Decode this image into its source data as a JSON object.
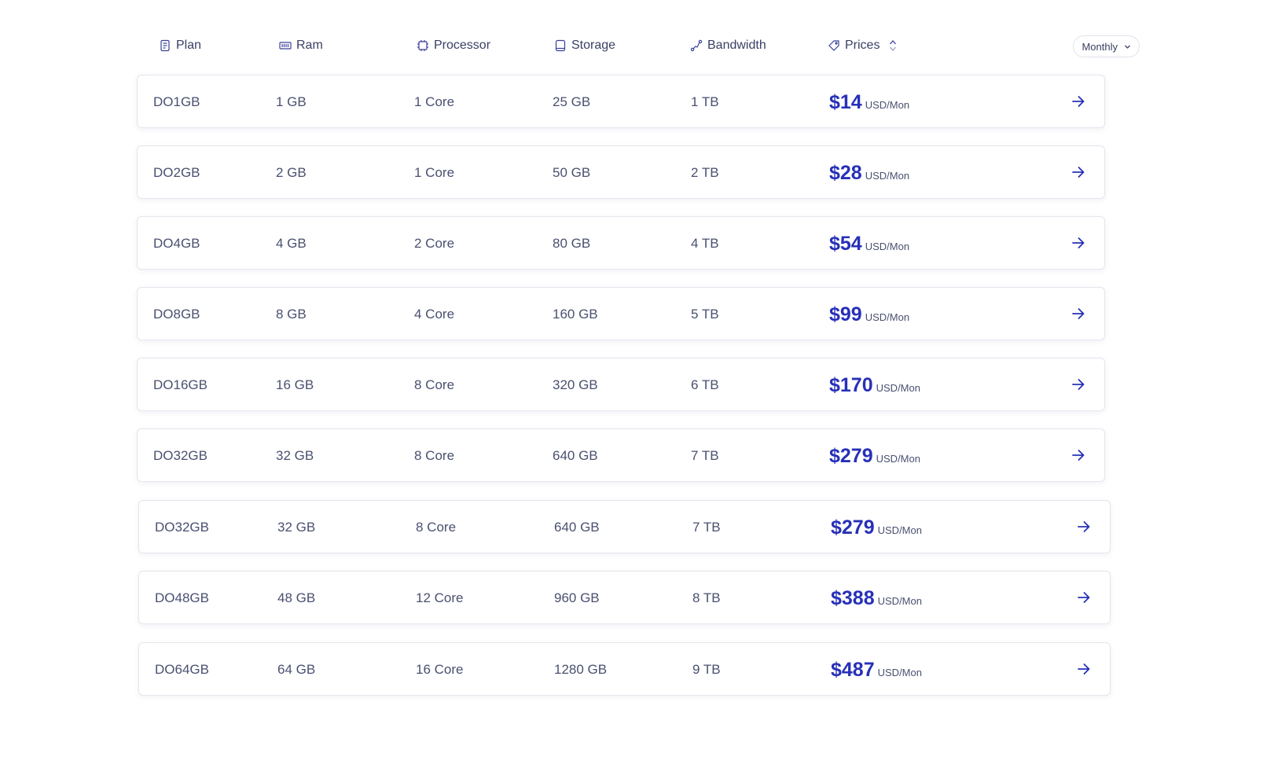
{
  "header": {
    "plan": "Plan",
    "ram": "Ram",
    "processor": "Processor",
    "storage": "Storage",
    "bandwidth": "Bandwidth",
    "prices": "Prices",
    "billing_select": "Monthly"
  },
  "rows": [
    {
      "plan": "DO1GB",
      "ram": "1 GB",
      "processor": "1 Core",
      "storage": "25 GB",
      "bandwidth": "1 TB",
      "price": "$14",
      "unit": "USD/Mon"
    },
    {
      "plan": "DO2GB",
      "ram": "2 GB",
      "processor": "1 Core",
      "storage": "50 GB",
      "bandwidth": "2 TB",
      "price": "$28",
      "unit": "USD/Mon"
    },
    {
      "plan": "DO4GB",
      "ram": "4 GB",
      "processor": "2 Core",
      "storage": "80 GB",
      "bandwidth": "4 TB",
      "price": "$54",
      "unit": "USD/Mon"
    },
    {
      "plan": "DO8GB",
      "ram": "8 GB",
      "processor": "4 Core",
      "storage": "160 GB",
      "bandwidth": "5 TB",
      "price": "$99",
      "unit": "USD/Mon"
    },
    {
      "plan": "DO16GB",
      "ram": "16 GB",
      "processor": "8 Core",
      "storage": "320 GB",
      "bandwidth": "6 TB",
      "price": "$170",
      "unit": "USD/Mon"
    },
    {
      "plan": "DO32GB",
      "ram": "32 GB",
      "processor": "8 Core",
      "storage": "640 GB",
      "bandwidth": "7 TB",
      "price": "$279",
      "unit": "USD/Mon"
    },
    {
      "plan": "DO32GB",
      "ram": "32 GB",
      "processor": "8 Core",
      "storage": "640 GB",
      "bandwidth": "7 TB",
      "price": "$279",
      "unit": "USD/Mon"
    },
    {
      "plan": "DO48GB",
      "ram": "48 GB",
      "processor": "12 Core",
      "storage": "960 GB",
      "bandwidth": "8 TB",
      "price": "$388",
      "unit": "USD/Mon"
    },
    {
      "plan": "DO64GB",
      "ram": "64 GB",
      "processor": "16 Core",
      "storage": "1280 GB",
      "bandwidth": "9 TB",
      "price": "$487",
      "unit": "USD/Mon"
    }
  ],
  "colors": {
    "accent": "#2730b8",
    "text": "#4a5070",
    "border": "#e3e6ee"
  },
  "icons": {
    "plan": "document-icon",
    "ram": "memory-icon",
    "processor": "cpu-icon",
    "storage": "tablet-icon",
    "bandwidth": "route-icon",
    "prices": "tag-icon",
    "sort": "sort-icon",
    "select": "chevron-down-icon",
    "row_action": "arrow-right-icon"
  }
}
